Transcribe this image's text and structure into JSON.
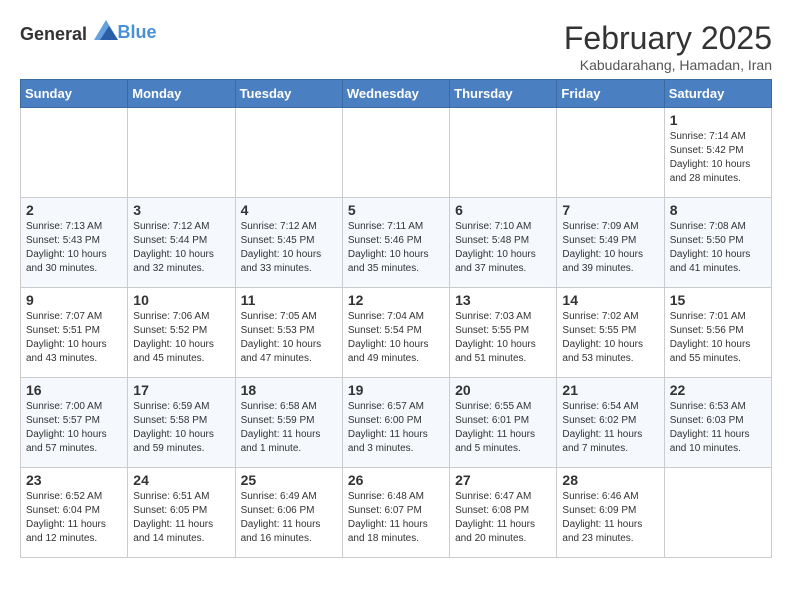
{
  "header": {
    "logo_general": "General",
    "logo_blue": "Blue",
    "month_title": "February 2025",
    "location": "Kabudarahang, Hamadan, Iran"
  },
  "days_of_week": [
    "Sunday",
    "Monday",
    "Tuesday",
    "Wednesday",
    "Thursday",
    "Friday",
    "Saturday"
  ],
  "weeks": [
    [
      {
        "day": "",
        "detail": ""
      },
      {
        "day": "",
        "detail": ""
      },
      {
        "day": "",
        "detail": ""
      },
      {
        "day": "",
        "detail": ""
      },
      {
        "day": "",
        "detail": ""
      },
      {
        "day": "",
        "detail": ""
      },
      {
        "day": "1",
        "detail": "Sunrise: 7:14 AM\nSunset: 5:42 PM\nDaylight: 10 hours\nand 28 minutes."
      }
    ],
    [
      {
        "day": "2",
        "detail": "Sunrise: 7:13 AM\nSunset: 5:43 PM\nDaylight: 10 hours\nand 30 minutes."
      },
      {
        "day": "3",
        "detail": "Sunrise: 7:12 AM\nSunset: 5:44 PM\nDaylight: 10 hours\nand 32 minutes."
      },
      {
        "day": "4",
        "detail": "Sunrise: 7:12 AM\nSunset: 5:45 PM\nDaylight: 10 hours\nand 33 minutes."
      },
      {
        "day": "5",
        "detail": "Sunrise: 7:11 AM\nSunset: 5:46 PM\nDaylight: 10 hours\nand 35 minutes."
      },
      {
        "day": "6",
        "detail": "Sunrise: 7:10 AM\nSunset: 5:48 PM\nDaylight: 10 hours\nand 37 minutes."
      },
      {
        "day": "7",
        "detail": "Sunrise: 7:09 AM\nSunset: 5:49 PM\nDaylight: 10 hours\nand 39 minutes."
      },
      {
        "day": "8",
        "detail": "Sunrise: 7:08 AM\nSunset: 5:50 PM\nDaylight: 10 hours\nand 41 minutes."
      }
    ],
    [
      {
        "day": "9",
        "detail": "Sunrise: 7:07 AM\nSunset: 5:51 PM\nDaylight: 10 hours\nand 43 minutes."
      },
      {
        "day": "10",
        "detail": "Sunrise: 7:06 AM\nSunset: 5:52 PM\nDaylight: 10 hours\nand 45 minutes."
      },
      {
        "day": "11",
        "detail": "Sunrise: 7:05 AM\nSunset: 5:53 PM\nDaylight: 10 hours\nand 47 minutes."
      },
      {
        "day": "12",
        "detail": "Sunrise: 7:04 AM\nSunset: 5:54 PM\nDaylight: 10 hours\nand 49 minutes."
      },
      {
        "day": "13",
        "detail": "Sunrise: 7:03 AM\nSunset: 5:55 PM\nDaylight: 10 hours\nand 51 minutes."
      },
      {
        "day": "14",
        "detail": "Sunrise: 7:02 AM\nSunset: 5:55 PM\nDaylight: 10 hours\nand 53 minutes."
      },
      {
        "day": "15",
        "detail": "Sunrise: 7:01 AM\nSunset: 5:56 PM\nDaylight: 10 hours\nand 55 minutes."
      }
    ],
    [
      {
        "day": "16",
        "detail": "Sunrise: 7:00 AM\nSunset: 5:57 PM\nDaylight: 10 hours\nand 57 minutes."
      },
      {
        "day": "17",
        "detail": "Sunrise: 6:59 AM\nSunset: 5:58 PM\nDaylight: 10 hours\nand 59 minutes."
      },
      {
        "day": "18",
        "detail": "Sunrise: 6:58 AM\nSunset: 5:59 PM\nDaylight: 11 hours\nand 1 minute."
      },
      {
        "day": "19",
        "detail": "Sunrise: 6:57 AM\nSunset: 6:00 PM\nDaylight: 11 hours\nand 3 minutes."
      },
      {
        "day": "20",
        "detail": "Sunrise: 6:55 AM\nSunset: 6:01 PM\nDaylight: 11 hours\nand 5 minutes."
      },
      {
        "day": "21",
        "detail": "Sunrise: 6:54 AM\nSunset: 6:02 PM\nDaylight: 11 hours\nand 7 minutes."
      },
      {
        "day": "22",
        "detail": "Sunrise: 6:53 AM\nSunset: 6:03 PM\nDaylight: 11 hours\nand 10 minutes."
      }
    ],
    [
      {
        "day": "23",
        "detail": "Sunrise: 6:52 AM\nSunset: 6:04 PM\nDaylight: 11 hours\nand 12 minutes."
      },
      {
        "day": "24",
        "detail": "Sunrise: 6:51 AM\nSunset: 6:05 PM\nDaylight: 11 hours\nand 14 minutes."
      },
      {
        "day": "25",
        "detail": "Sunrise: 6:49 AM\nSunset: 6:06 PM\nDaylight: 11 hours\nand 16 minutes."
      },
      {
        "day": "26",
        "detail": "Sunrise: 6:48 AM\nSunset: 6:07 PM\nDaylight: 11 hours\nand 18 minutes."
      },
      {
        "day": "27",
        "detail": "Sunrise: 6:47 AM\nSunset: 6:08 PM\nDaylight: 11 hours\nand 20 minutes."
      },
      {
        "day": "28",
        "detail": "Sunrise: 6:46 AM\nSunset: 6:09 PM\nDaylight: 11 hours\nand 23 minutes."
      },
      {
        "day": "",
        "detail": ""
      }
    ]
  ]
}
